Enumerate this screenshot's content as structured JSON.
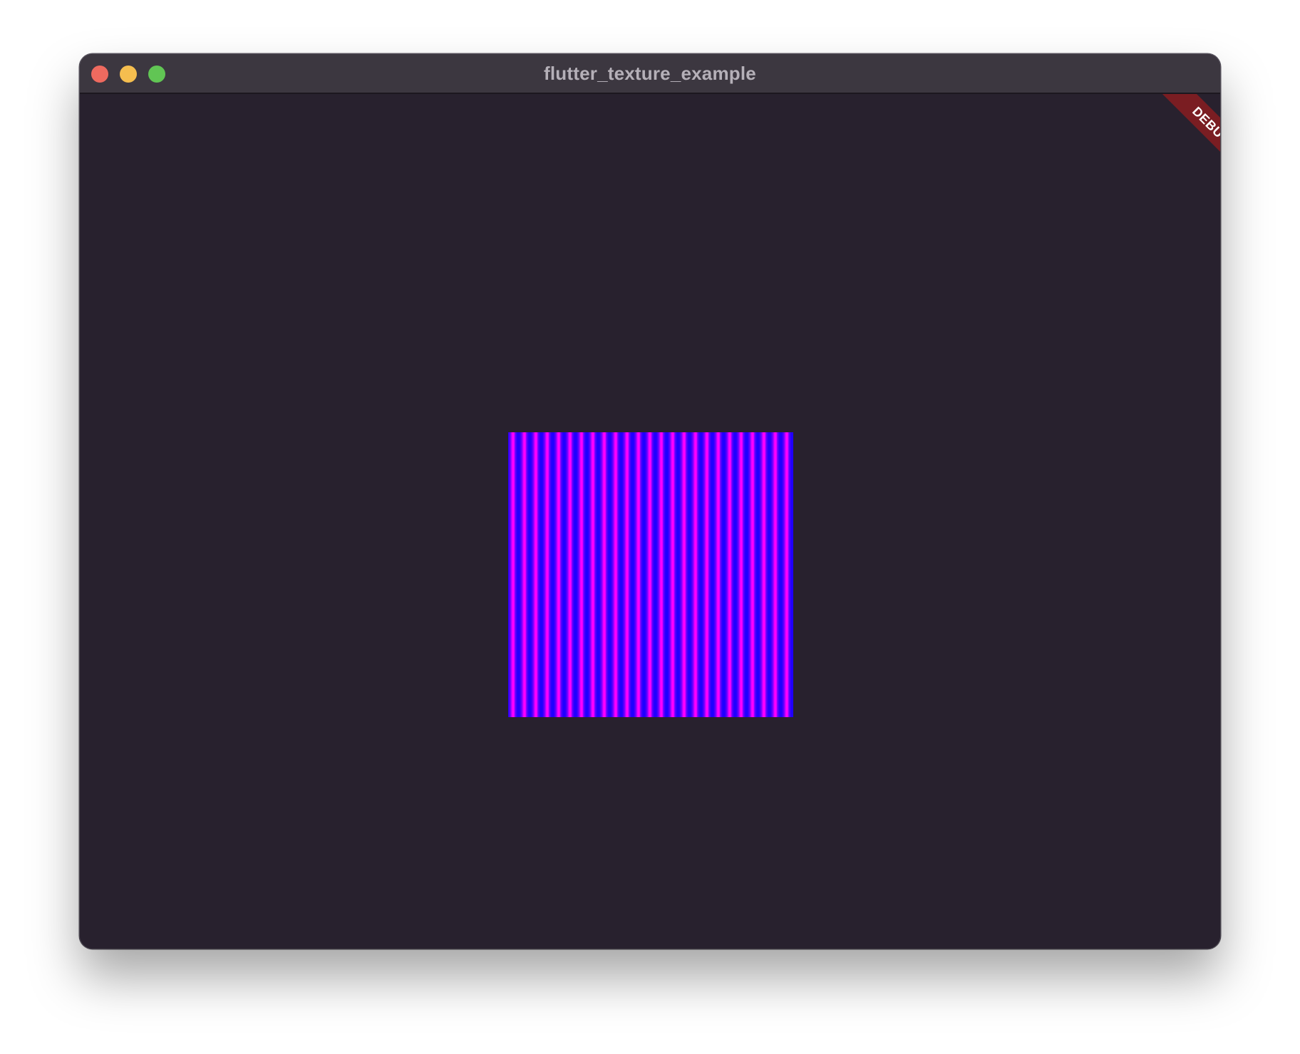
{
  "window": {
    "title": "flutter_texture_example"
  },
  "traffic_lights": {
    "close_color": "#ee6a5f",
    "minimize_color": "#f5be4f",
    "zoom_color": "#61c554"
  },
  "debug_banner": {
    "label": "DEBUG",
    "color": "#7a1d22"
  },
  "texture": {
    "colors": [
      "#2000ff",
      "#ff00ff"
    ]
  },
  "colors": {
    "background": "#28212e",
    "titlebar": "#3c3740"
  }
}
